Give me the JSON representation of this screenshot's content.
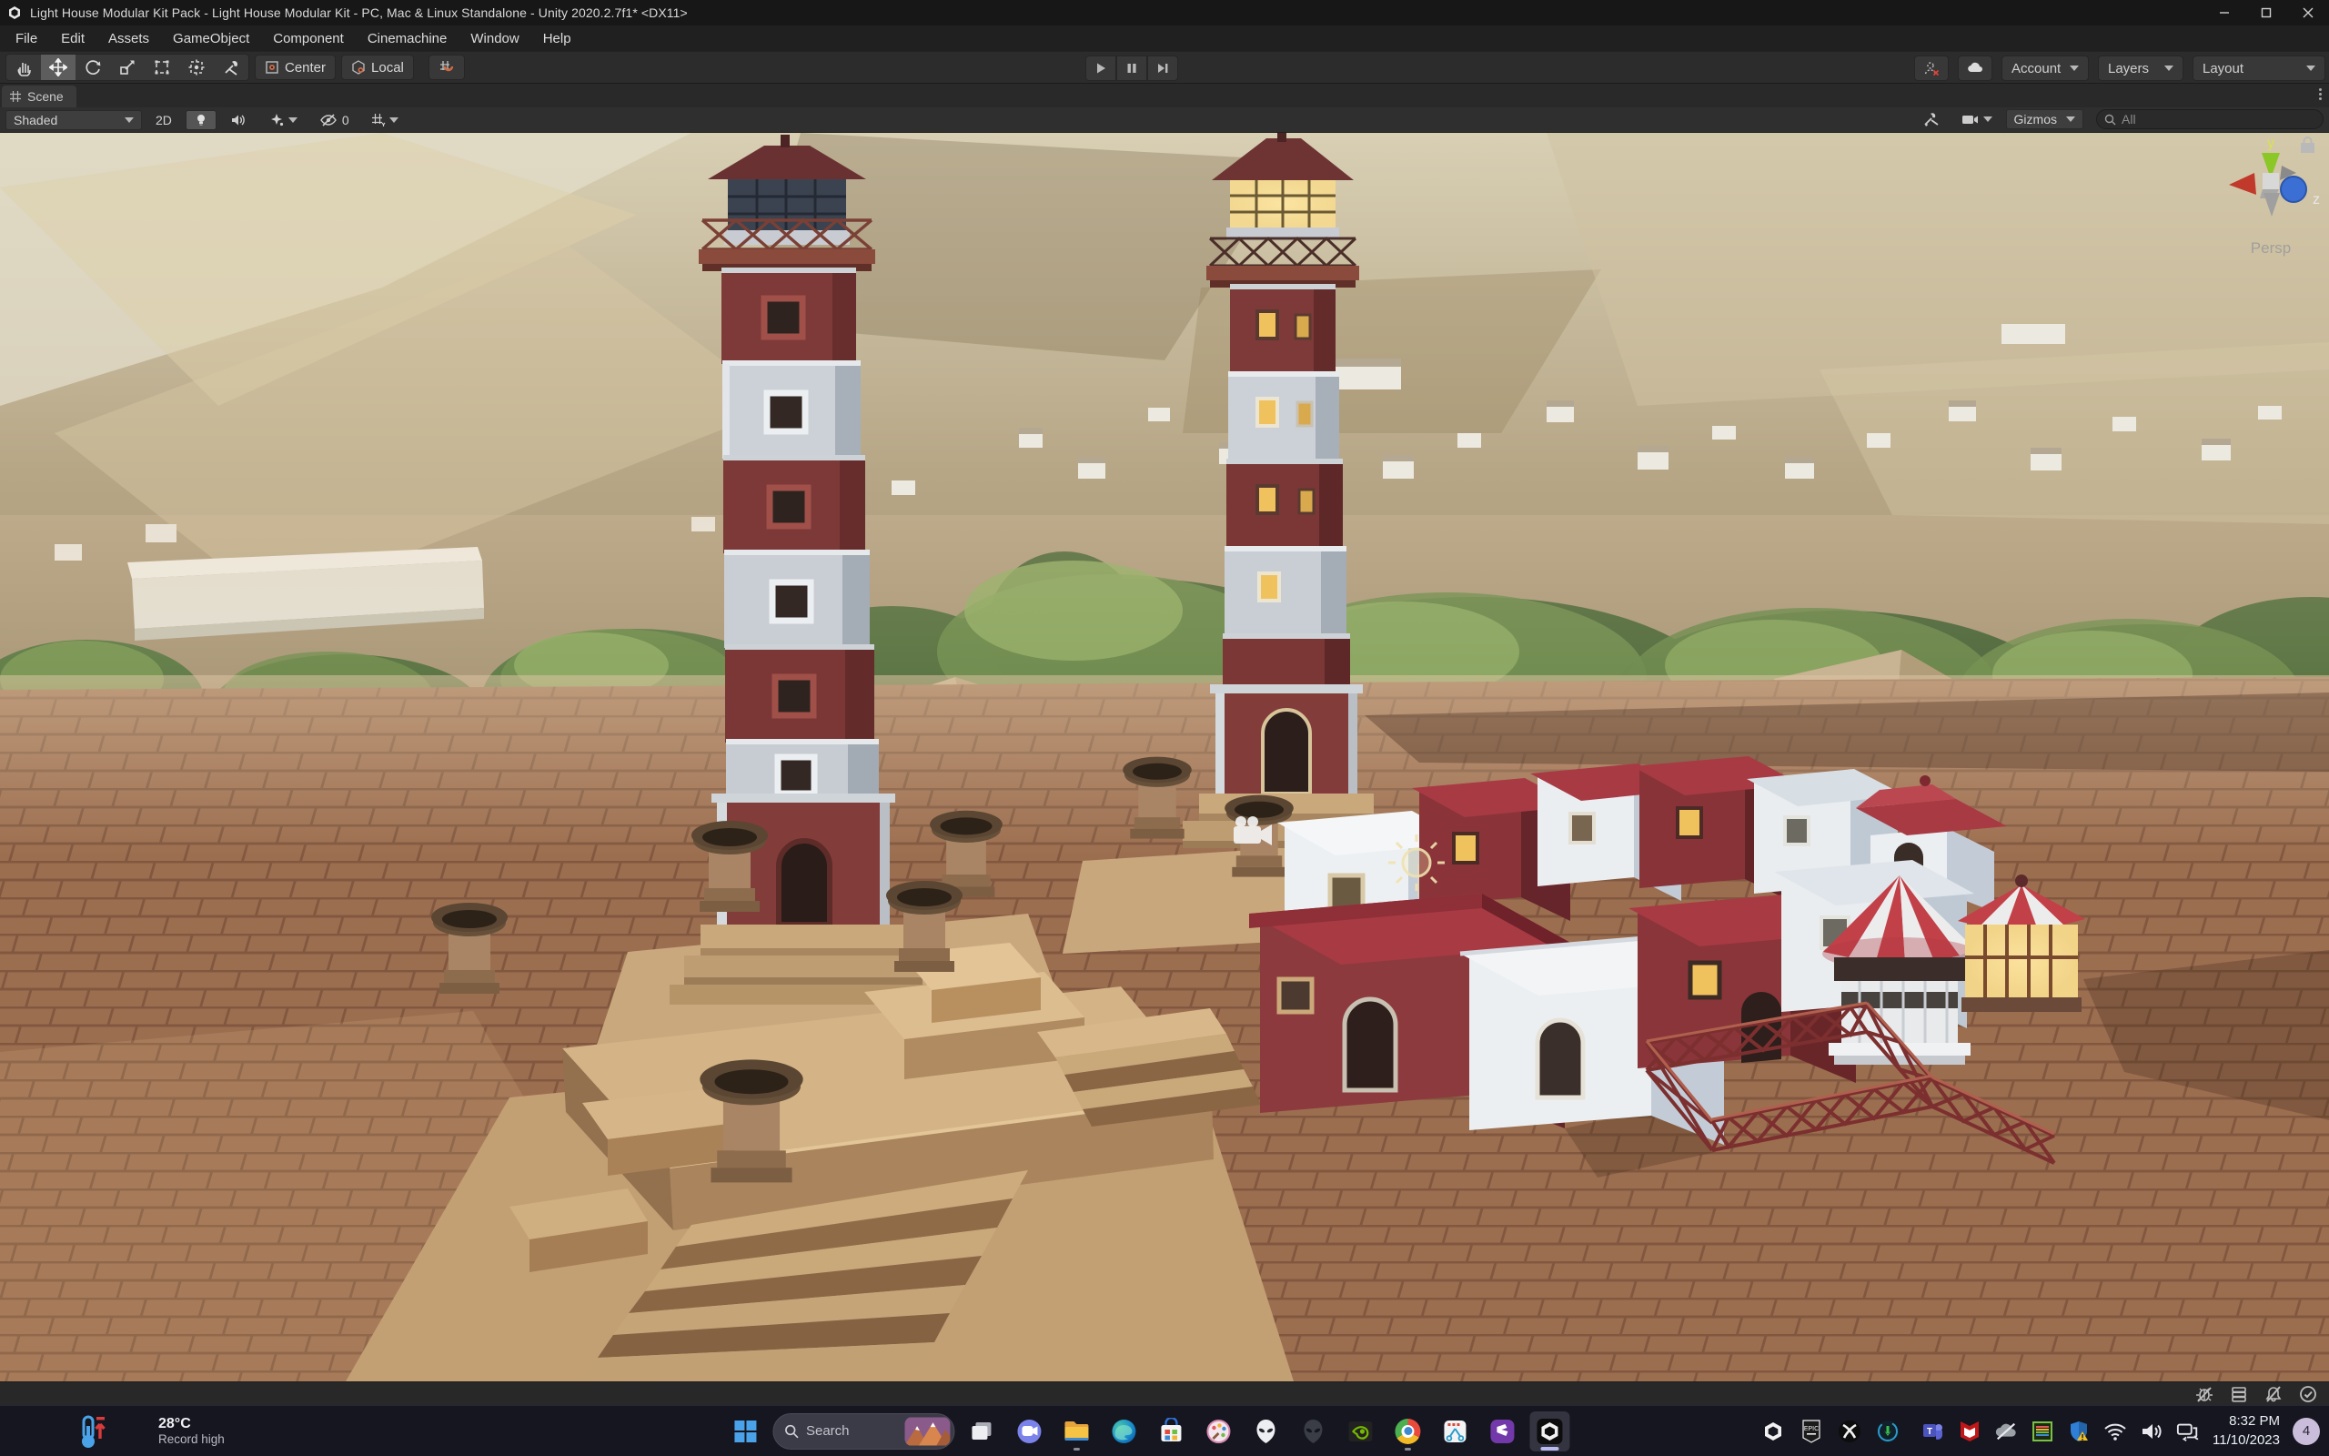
{
  "window": {
    "title": "Light House Modular Kit Pack - Light House Modular Kit - PC, Mac & Linux Standalone - Unity 2020.2.7f1* <DX11>"
  },
  "menu": {
    "items": [
      "File",
      "Edit",
      "Assets",
      "GameObject",
      "Component",
      "Cinemachine",
      "Window",
      "Help"
    ]
  },
  "toolbar": {
    "tools": [
      "hand",
      "move",
      "rotate",
      "scale",
      "rect",
      "transform",
      "custom"
    ],
    "selected_tool": "move",
    "pivot": "Center",
    "orientation": "Local",
    "account": "Account",
    "layers": "Layers",
    "layout": "Layout"
  },
  "scene_panel": {
    "tab": "Scene",
    "shading_mode": "Shaded",
    "mode_2d": "2D",
    "hidden_count": "0",
    "gizmos": "Gizmos",
    "search_placeholder": "All",
    "axis_y": "y",
    "axis_z": "z",
    "projection": "Persp"
  },
  "viewport_icons": [
    "camera-gizmo",
    "directional-light-sun-gizmo",
    "orientation-axis-gizmo",
    "lock-icon"
  ],
  "statusbar_icons": [
    "debugger-icon",
    "cache-server-icon",
    "notifications-muted-icon",
    "progress-idle-icon"
  ],
  "taskbar": {
    "weather": {
      "temp": "28°C",
      "desc": "Record high"
    },
    "search_placeholder": "Search",
    "pinned": [
      "start",
      "search",
      "task-view",
      "chat",
      "file-explorer",
      "edge",
      "microsoft-store",
      "paint",
      "alienware",
      "alienware-command-center",
      "nvidia",
      "chrome",
      "snipping-tool",
      "clipchamp",
      "unity-hub"
    ],
    "active_app": "unity-hub",
    "tray": [
      "unity-editor",
      "epic-games",
      "xbox",
      "dell-update",
      "teams",
      "mcafee",
      "onedrive",
      "display-colors",
      "windows-security-warning",
      "wifi",
      "volume",
      "screen-sync"
    ],
    "clock": {
      "time": "8:32 PM",
      "date": "11/10/2023"
    },
    "badge": "4"
  },
  "colors": {
    "lighthouse_red": "#7e3a38",
    "roof_crimson": "#a83a44",
    "ground_brick": "#9c6e50",
    "sand_stone": "#d2b183",
    "selected_tool_bg": "#5d5d5d",
    "badge_bg": "#cabddb",
    "taskbar_bg": "#151620"
  }
}
